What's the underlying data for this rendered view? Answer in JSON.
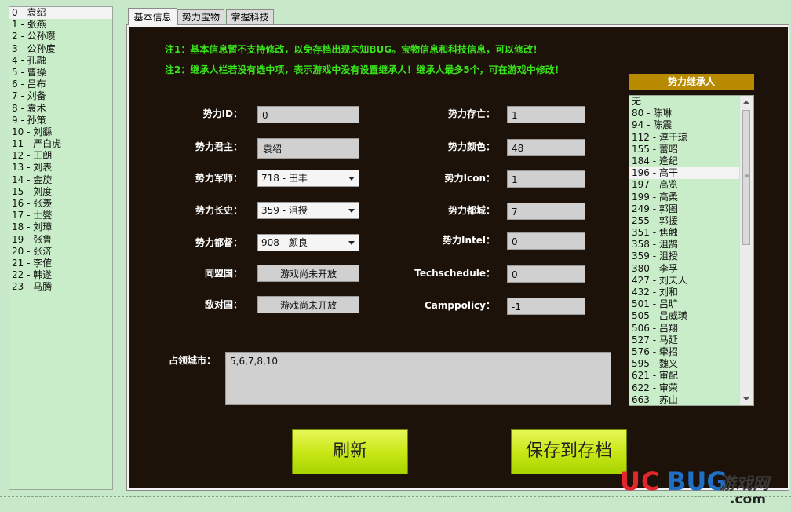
{
  "factions": {
    "selected_index": 0,
    "items": [
      "0 - 袁绍",
      "1 - 张燕",
      "2 - 公孙瓒",
      "3 - 公孙度",
      "4 - 孔融",
      "5 - 曹操",
      "6 - 吕布",
      "7 - 刘备",
      "8 - 袁术",
      "9 - 孙策",
      "10 - 刘繇",
      "11 - 严白虎",
      "12 - 王朗",
      "13 - 刘表",
      "14 - 金旋",
      "15 - 刘度",
      "16 - 张羡",
      "17 - 士燮",
      "18 - 刘璋",
      "19 - 张鲁",
      "20 - 张济",
      "21 - 李傕",
      "22 - 韩遂",
      "23 - 马腾"
    ]
  },
  "tabs": [
    {
      "label": "基本信息",
      "active": true
    },
    {
      "label": "势力宝物",
      "active": false
    },
    {
      "label": "掌握科技",
      "active": false
    }
  ],
  "notes": {
    "note1": "注1：基本信息暂不支持修改，以免存档出现未知BUG。宝物信息和科技信息，可以修改！",
    "note2": "注2：继承人栏若没有选中项，表示游戏中没有设置继承人！继承人最多5个，可在游戏中修改！"
  },
  "form": {
    "faction_id": {
      "label": "势力ID：",
      "value": "0"
    },
    "ruler": {
      "label": "势力君主：",
      "value": "袁绍"
    },
    "advisor": {
      "label": "势力军师：",
      "value": "718 - 田丰"
    },
    "chief_clerk": {
      "label": "势力长史：",
      "value": "359 - 沮授"
    },
    "commander": {
      "label": "势力都督：",
      "value": "908 - 颜良"
    },
    "alliance": {
      "label": "同盟国：",
      "value": "游戏尚未开放"
    },
    "enemy": {
      "label": "敌对国：",
      "value": "游戏尚未开放"
    },
    "alive": {
      "label": "势力存亡：",
      "value": "1"
    },
    "color": {
      "label": "势力颜色：",
      "value": "48"
    },
    "icon": {
      "label": "势力Icon：",
      "value": "1"
    },
    "capital": {
      "label": "势力都城：",
      "value": "7"
    },
    "intel": {
      "label": "势力Intel：",
      "value": "0"
    },
    "techschedule": {
      "label": "Techschedule：",
      "value": "0"
    },
    "camppolicy": {
      "label": "Camppolicy：",
      "value": "-1"
    },
    "cities": {
      "label": "占领城市：",
      "value": "5,6,7,8,10"
    }
  },
  "heirs": {
    "title": "势力继承人",
    "selected_index": 6,
    "items": [
      "无",
      "80 - 陈琳",
      "94 - 陈震",
      "112 - 淳于琼",
      "155 - 蕾昭",
      "184 - 逢纪",
      "196 - 高干",
      "197 - 高览",
      "199 - 高柔",
      "249 - 郭图",
      "255 - 郭援",
      "351 - 焦触",
      "358 - 沮鹄",
      "359 - 沮授",
      "380 - 李孚",
      "427 - 刘夫人",
      "432 - 刘和",
      "501 - 吕旷",
      "505 - 吕威璜",
      "506 - 吕翔",
      "527 - 马延",
      "576 - 牵招",
      "595 - 魏义",
      "621 - 审配",
      "622 - 审荣",
      "663 - 苏由"
    ]
  },
  "buttons": {
    "refresh": "刷新",
    "save": "保存到存档"
  },
  "watermark": {
    "uc": "UC",
    "bug": "BUG",
    "cn": "游戏网",
    "com": ".com"
  },
  "colors": {
    "accent_green_text": "#39e51a",
    "heir_header": "#b88a00",
    "panel_bg": "#1c120a",
    "button_yellow_green": "#c9e818"
  }
}
